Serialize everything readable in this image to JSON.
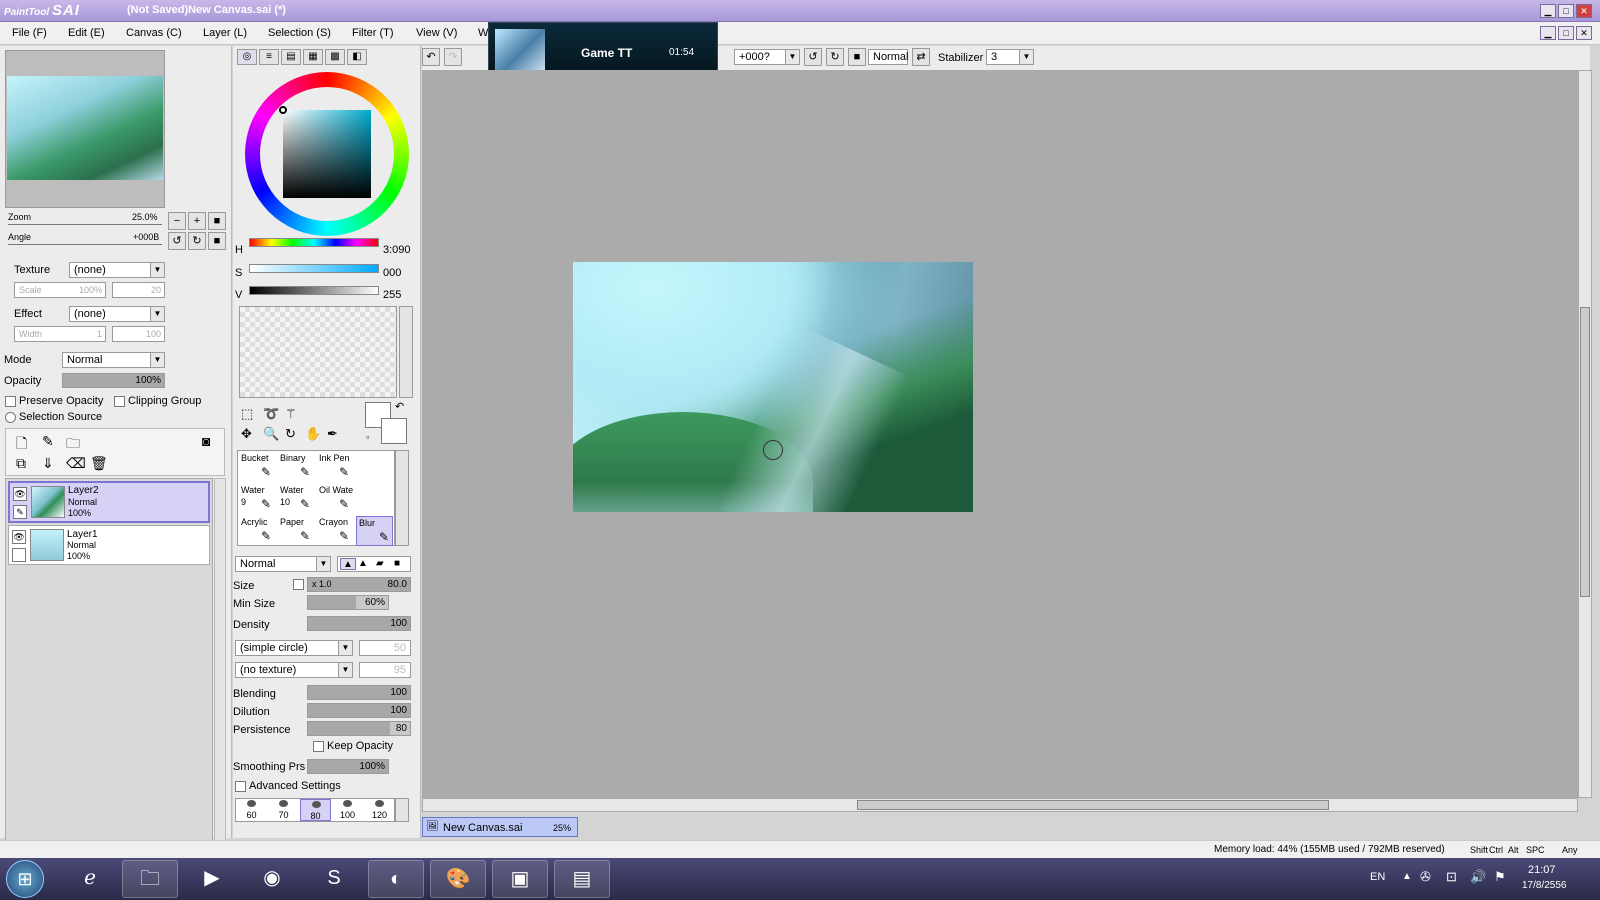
{
  "window": {
    "app_logo_small": "PaintTool",
    "app_logo_big": "SAI",
    "title": "(Not Saved)New Canvas.sai (*)"
  },
  "menu": [
    "File (F)",
    "Edit (E)",
    "Canvas (C)",
    "Layer (L)",
    "Selection (S)",
    "Filter (T)",
    "View (V)",
    "W"
  ],
  "notification": {
    "title": "Game TT",
    "time": "01:54"
  },
  "toolbar": {
    "angle_value": "+000?",
    "blend_mode": "Normal",
    "stabilizer_label": "Stabilizer",
    "stabilizer_value": "3"
  },
  "navigator": {
    "zoom_label": "Zoom",
    "zoom_value": "25.0%",
    "angle_label": "Angle",
    "angle_value": "+000B"
  },
  "texture": {
    "label": "Texture",
    "value": "(none)",
    "scale_label": "Scale",
    "scale_value": "100%",
    "scale_num": "20"
  },
  "effect": {
    "label": "Effect",
    "value": "(none)",
    "width_label": "Width",
    "width_value": "1",
    "width_num": "100"
  },
  "layer_props": {
    "mode_label": "Mode",
    "mode_value": "Normal",
    "opacity_label": "Opacity",
    "opacity_value": "100%",
    "opacity_fraction": 1.0,
    "preserve_opacity": "Preserve Opacity",
    "clipping_group": "Clipping Group",
    "selection_source": "Selection Source"
  },
  "layers": [
    {
      "name": "Layer2",
      "mode": "Normal",
      "opacity": "100%",
      "selected": true
    },
    {
      "name": "Layer1",
      "mode": "Normal",
      "opacity": "100%",
      "selected": false
    }
  ],
  "color": {
    "h_label": "H",
    "h_value": "3:090",
    "s_label": "S",
    "s_value": "000",
    "v_label": "V",
    "v_value": "255"
  },
  "tools": [
    {
      "name": "Bucket",
      "sub": ""
    },
    {
      "name": "Binary",
      "sub": ""
    },
    {
      "name": "Ink Pen",
      "sub": ""
    },
    {
      "name": "Water",
      "sub": "9"
    },
    {
      "name": "Water",
      "sub": "10"
    },
    {
      "name": "Oil Wate",
      "sub": ""
    },
    {
      "name": "Acrylic",
      "sub": ""
    },
    {
      "name": "Paper",
      "sub": ""
    },
    {
      "name": "Crayon",
      "sub": ""
    },
    {
      "name": "Blur",
      "sub": ""
    }
  ],
  "brush": {
    "mode": "Normal",
    "size_label": "Size",
    "size_mult": "x 1.0",
    "size_value": "80.0",
    "minsize_label": "Min Size",
    "minsize_value": "60%",
    "minsize_fraction": 0.6,
    "density_label": "Density",
    "density_value": "100",
    "shape": "(simple circle)",
    "shape_num": "50",
    "texture": "(no texture)",
    "texture_num": "95",
    "blending_label": "Blending",
    "blending_value": "100",
    "dilution_label": "Dilution",
    "dilution_value": "100",
    "persistence_label": "Persistence",
    "persistence_value": "80",
    "persistence_fraction": 0.8,
    "keep_opacity": "Keep Opacity",
    "smoothing_label": "Smoothing Prs",
    "smoothing_value": "100%",
    "advanced": "Advanced Settings",
    "sizes": [
      "60",
      "70",
      "80",
      "100",
      "120"
    ]
  },
  "canvas_tab": {
    "name": "New Canvas.sai",
    "zoom": "25%"
  },
  "status": {
    "memory": "Memory load: 44% (155MB used / 792MB reserved)",
    "keys": [
      "Shift",
      "Ctrl",
      "Alt",
      "SPC",
      "Any"
    ]
  },
  "taskbar": {
    "lang": "EN",
    "time": "21:07",
    "date": "17/8/2556"
  }
}
